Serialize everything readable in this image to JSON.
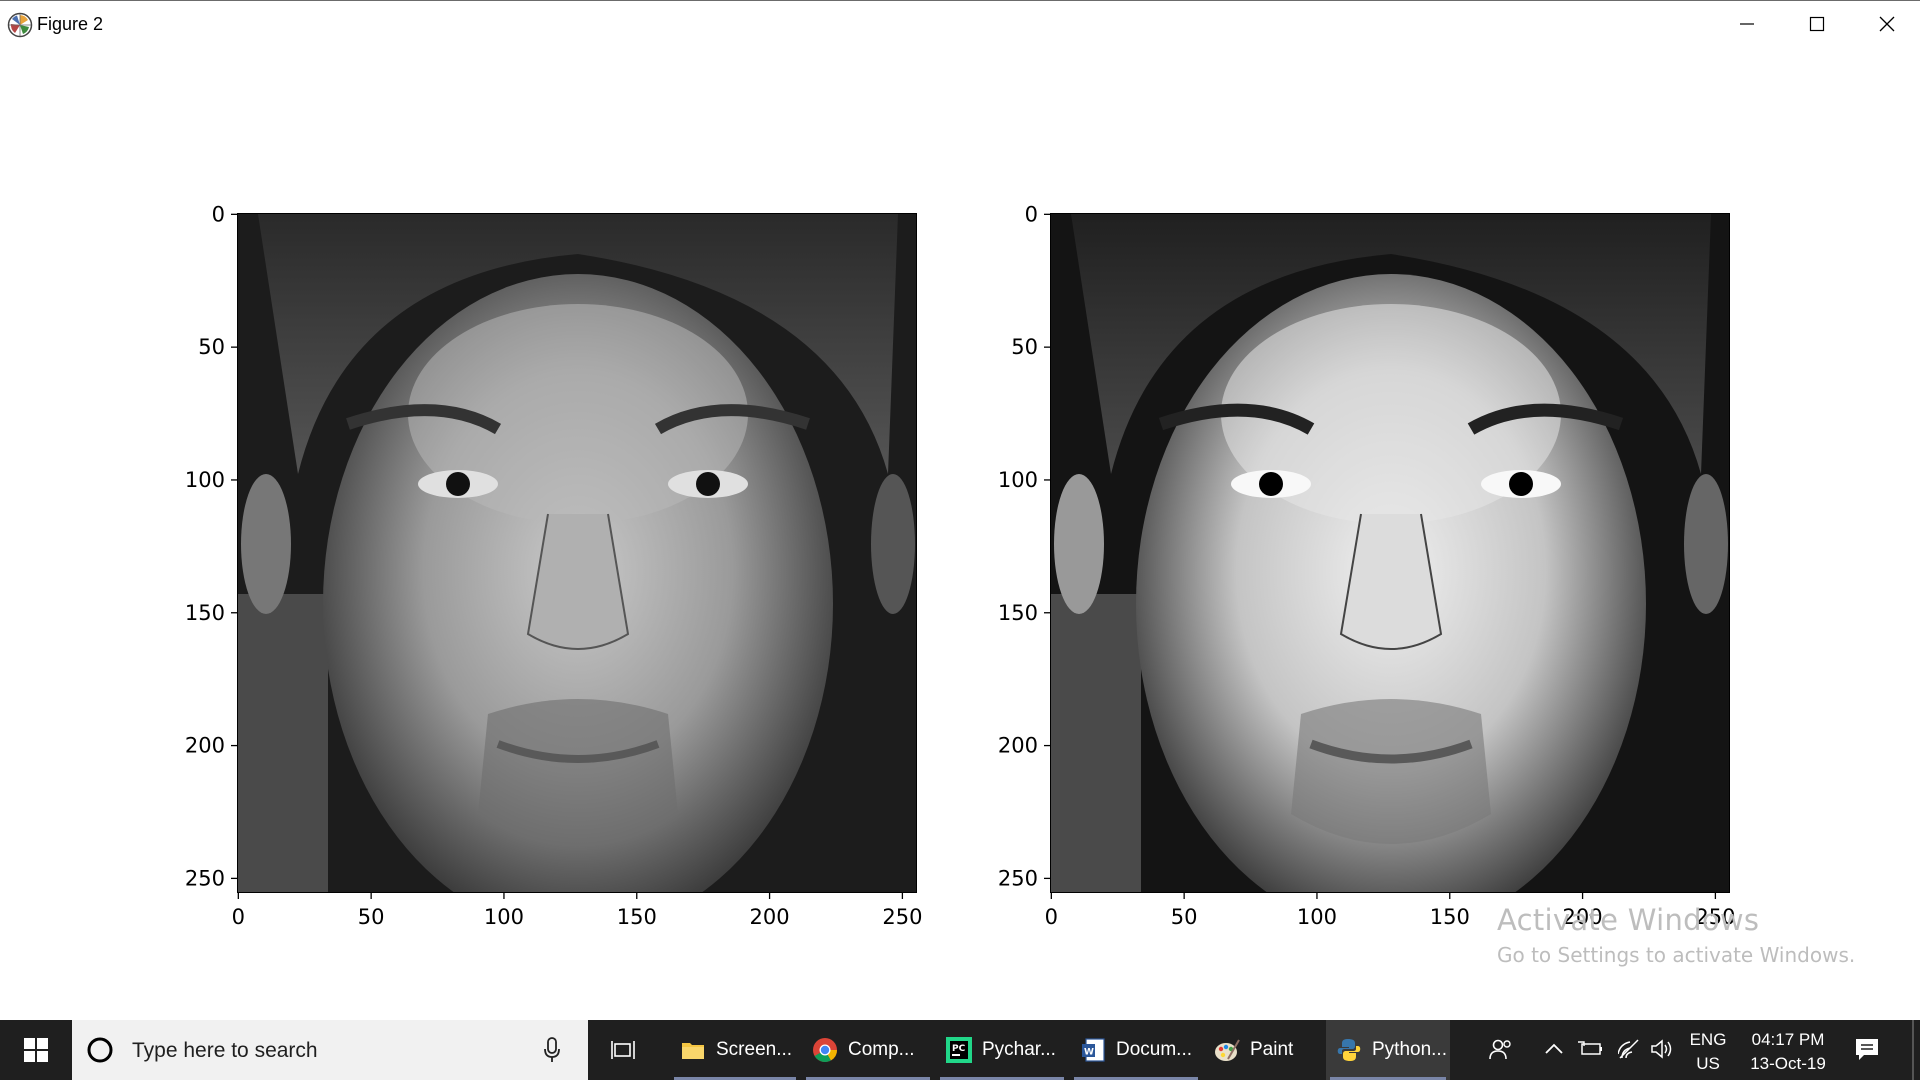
{
  "window": {
    "title": "Figure 2",
    "icon": "matplotlib-icon",
    "controls": [
      "minimize-icon",
      "maximize-icon",
      "close-icon"
    ]
  },
  "figure": {
    "panels": [
      {
        "name": "original-face-image",
        "x_ticks": [
          "0",
          "50",
          "100",
          "150",
          "200",
          "250"
        ],
        "y_ticks": [
          "0",
          "50",
          "100",
          "150",
          "200",
          "250"
        ]
      },
      {
        "name": "enhanced-face-image",
        "x_ticks": [
          "0",
          "50",
          "100",
          "150",
          "200",
          "250"
        ],
        "y_ticks": [
          "0",
          "50",
          "100",
          "150",
          "200",
          "250"
        ]
      }
    ]
  },
  "watermark": {
    "title": "Activate Windows",
    "subtitle": "Go to Settings to activate Windows."
  },
  "taskbar": {
    "search_placeholder": "Type here to search",
    "apps": [
      {
        "label": "Screen...",
        "icon": "folder-icon"
      },
      {
        "label": "Comp...",
        "icon": "chrome-icon"
      },
      {
        "label": "Pychar...",
        "icon": "pycharm-icon"
      },
      {
        "label": "Docum...",
        "icon": "word-document-icon"
      },
      {
        "label": "Paint",
        "icon": "paint-icon"
      },
      {
        "label": "Python...",
        "icon": "python-icon"
      }
    ],
    "lang_line1": "ENG",
    "lang_line2": "US",
    "time": "04:17 PM",
    "date": "13-Oct-19"
  },
  "colors": {
    "taskbar_bg": "#1f1f1f",
    "search_bg": "#f1f1f1",
    "active_app_bg": "#3a3a3a",
    "watermark": "#bdbdbd"
  }
}
